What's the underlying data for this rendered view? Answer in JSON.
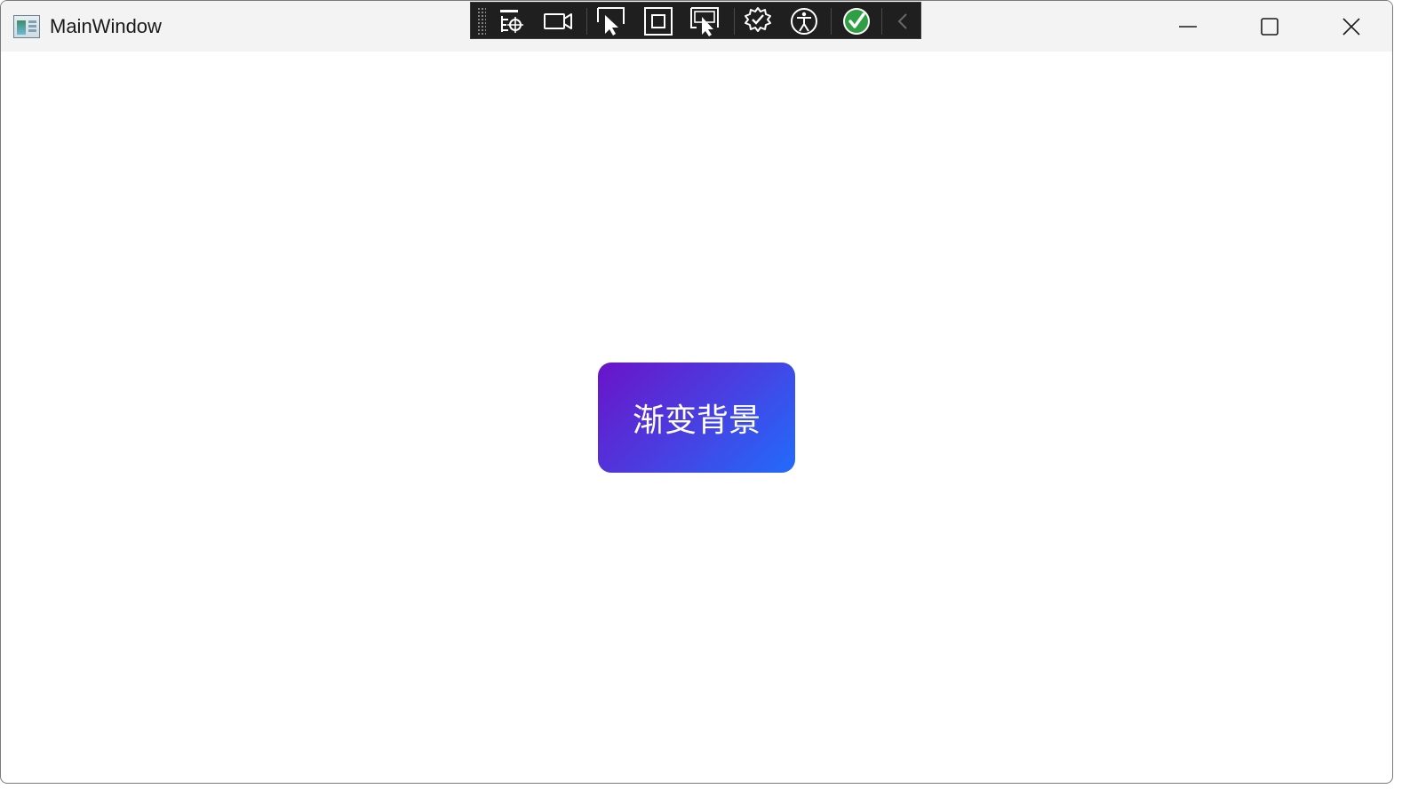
{
  "window": {
    "title": "MainWindow"
  },
  "devtools": {
    "items": [
      {
        "name": "select-element-icon"
      },
      {
        "name": "record-icon"
      },
      {
        "name": "pointer-select-icon"
      },
      {
        "name": "layout-adorner-icon"
      },
      {
        "name": "track-focus-icon"
      },
      {
        "name": "binding-failures-icon"
      },
      {
        "name": "accessibility-icon"
      },
      {
        "name": "checkmark-status-icon"
      },
      {
        "name": "collapse-chevron-icon"
      }
    ]
  },
  "content": {
    "button_label": "渐变背景"
  },
  "colors": {
    "gradient_start": "#6a14c9",
    "gradient_end": "#216cfb",
    "titlebar_bg": "#f3f3f3",
    "devbar_bg": "#1f1f1f",
    "status_green": "#2ea043"
  }
}
